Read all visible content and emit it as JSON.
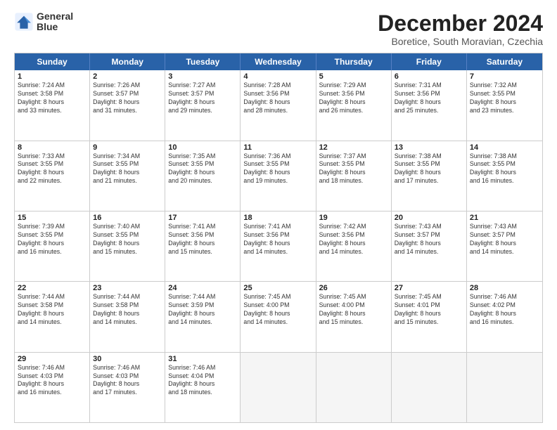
{
  "logo": {
    "line1": "General",
    "line2": "Blue"
  },
  "title": "December 2024",
  "subtitle": "Boretice, South Moravian, Czechia",
  "weekdays": [
    "Sunday",
    "Monday",
    "Tuesday",
    "Wednesday",
    "Thursday",
    "Friday",
    "Saturday"
  ],
  "rows": [
    [
      {
        "day": "1",
        "lines": [
          "Sunrise: 7:24 AM",
          "Sunset: 3:58 PM",
          "Daylight: 8 hours",
          "and 33 minutes."
        ]
      },
      {
        "day": "2",
        "lines": [
          "Sunrise: 7:26 AM",
          "Sunset: 3:57 PM",
          "Daylight: 8 hours",
          "and 31 minutes."
        ]
      },
      {
        "day": "3",
        "lines": [
          "Sunrise: 7:27 AM",
          "Sunset: 3:57 PM",
          "Daylight: 8 hours",
          "and 29 minutes."
        ]
      },
      {
        "day": "4",
        "lines": [
          "Sunrise: 7:28 AM",
          "Sunset: 3:56 PM",
          "Daylight: 8 hours",
          "and 28 minutes."
        ]
      },
      {
        "day": "5",
        "lines": [
          "Sunrise: 7:29 AM",
          "Sunset: 3:56 PM",
          "Daylight: 8 hours",
          "and 26 minutes."
        ]
      },
      {
        "day": "6",
        "lines": [
          "Sunrise: 7:31 AM",
          "Sunset: 3:56 PM",
          "Daylight: 8 hours",
          "and 25 minutes."
        ]
      },
      {
        "day": "7",
        "lines": [
          "Sunrise: 7:32 AM",
          "Sunset: 3:55 PM",
          "Daylight: 8 hours",
          "and 23 minutes."
        ]
      }
    ],
    [
      {
        "day": "8",
        "lines": [
          "Sunrise: 7:33 AM",
          "Sunset: 3:55 PM",
          "Daylight: 8 hours",
          "and 22 minutes."
        ]
      },
      {
        "day": "9",
        "lines": [
          "Sunrise: 7:34 AM",
          "Sunset: 3:55 PM",
          "Daylight: 8 hours",
          "and 21 minutes."
        ]
      },
      {
        "day": "10",
        "lines": [
          "Sunrise: 7:35 AM",
          "Sunset: 3:55 PM",
          "Daylight: 8 hours",
          "and 20 minutes."
        ]
      },
      {
        "day": "11",
        "lines": [
          "Sunrise: 7:36 AM",
          "Sunset: 3:55 PM",
          "Daylight: 8 hours",
          "and 19 minutes."
        ]
      },
      {
        "day": "12",
        "lines": [
          "Sunrise: 7:37 AM",
          "Sunset: 3:55 PM",
          "Daylight: 8 hours",
          "and 18 minutes."
        ]
      },
      {
        "day": "13",
        "lines": [
          "Sunrise: 7:38 AM",
          "Sunset: 3:55 PM",
          "Daylight: 8 hours",
          "and 17 minutes."
        ]
      },
      {
        "day": "14",
        "lines": [
          "Sunrise: 7:38 AM",
          "Sunset: 3:55 PM",
          "Daylight: 8 hours",
          "and 16 minutes."
        ]
      }
    ],
    [
      {
        "day": "15",
        "lines": [
          "Sunrise: 7:39 AM",
          "Sunset: 3:55 PM",
          "Daylight: 8 hours",
          "and 16 minutes."
        ]
      },
      {
        "day": "16",
        "lines": [
          "Sunrise: 7:40 AM",
          "Sunset: 3:55 PM",
          "Daylight: 8 hours",
          "and 15 minutes."
        ]
      },
      {
        "day": "17",
        "lines": [
          "Sunrise: 7:41 AM",
          "Sunset: 3:56 PM",
          "Daylight: 8 hours",
          "and 15 minutes."
        ]
      },
      {
        "day": "18",
        "lines": [
          "Sunrise: 7:41 AM",
          "Sunset: 3:56 PM",
          "Daylight: 8 hours",
          "and 14 minutes."
        ]
      },
      {
        "day": "19",
        "lines": [
          "Sunrise: 7:42 AM",
          "Sunset: 3:56 PM",
          "Daylight: 8 hours",
          "and 14 minutes."
        ]
      },
      {
        "day": "20",
        "lines": [
          "Sunrise: 7:43 AM",
          "Sunset: 3:57 PM",
          "Daylight: 8 hours",
          "and 14 minutes."
        ]
      },
      {
        "day": "21",
        "lines": [
          "Sunrise: 7:43 AM",
          "Sunset: 3:57 PM",
          "Daylight: 8 hours",
          "and 14 minutes."
        ]
      }
    ],
    [
      {
        "day": "22",
        "lines": [
          "Sunrise: 7:44 AM",
          "Sunset: 3:58 PM",
          "Daylight: 8 hours",
          "and 14 minutes."
        ]
      },
      {
        "day": "23",
        "lines": [
          "Sunrise: 7:44 AM",
          "Sunset: 3:58 PM",
          "Daylight: 8 hours",
          "and 14 minutes."
        ]
      },
      {
        "day": "24",
        "lines": [
          "Sunrise: 7:44 AM",
          "Sunset: 3:59 PM",
          "Daylight: 8 hours",
          "and 14 minutes."
        ]
      },
      {
        "day": "25",
        "lines": [
          "Sunrise: 7:45 AM",
          "Sunset: 4:00 PM",
          "Daylight: 8 hours",
          "and 14 minutes."
        ]
      },
      {
        "day": "26",
        "lines": [
          "Sunrise: 7:45 AM",
          "Sunset: 4:00 PM",
          "Daylight: 8 hours",
          "and 15 minutes."
        ]
      },
      {
        "day": "27",
        "lines": [
          "Sunrise: 7:45 AM",
          "Sunset: 4:01 PM",
          "Daylight: 8 hours",
          "and 15 minutes."
        ]
      },
      {
        "day": "28",
        "lines": [
          "Sunrise: 7:46 AM",
          "Sunset: 4:02 PM",
          "Daylight: 8 hours",
          "and 16 minutes."
        ]
      }
    ],
    [
      {
        "day": "29",
        "lines": [
          "Sunrise: 7:46 AM",
          "Sunset: 4:03 PM",
          "Daylight: 8 hours",
          "and 16 minutes."
        ]
      },
      {
        "day": "30",
        "lines": [
          "Sunrise: 7:46 AM",
          "Sunset: 4:03 PM",
          "Daylight: 8 hours",
          "and 17 minutes."
        ]
      },
      {
        "day": "31",
        "lines": [
          "Sunrise: 7:46 AM",
          "Sunset: 4:04 PM",
          "Daylight: 8 hours",
          "and 18 minutes."
        ]
      },
      {
        "day": "",
        "lines": []
      },
      {
        "day": "",
        "lines": []
      },
      {
        "day": "",
        "lines": []
      },
      {
        "day": "",
        "lines": []
      }
    ]
  ]
}
